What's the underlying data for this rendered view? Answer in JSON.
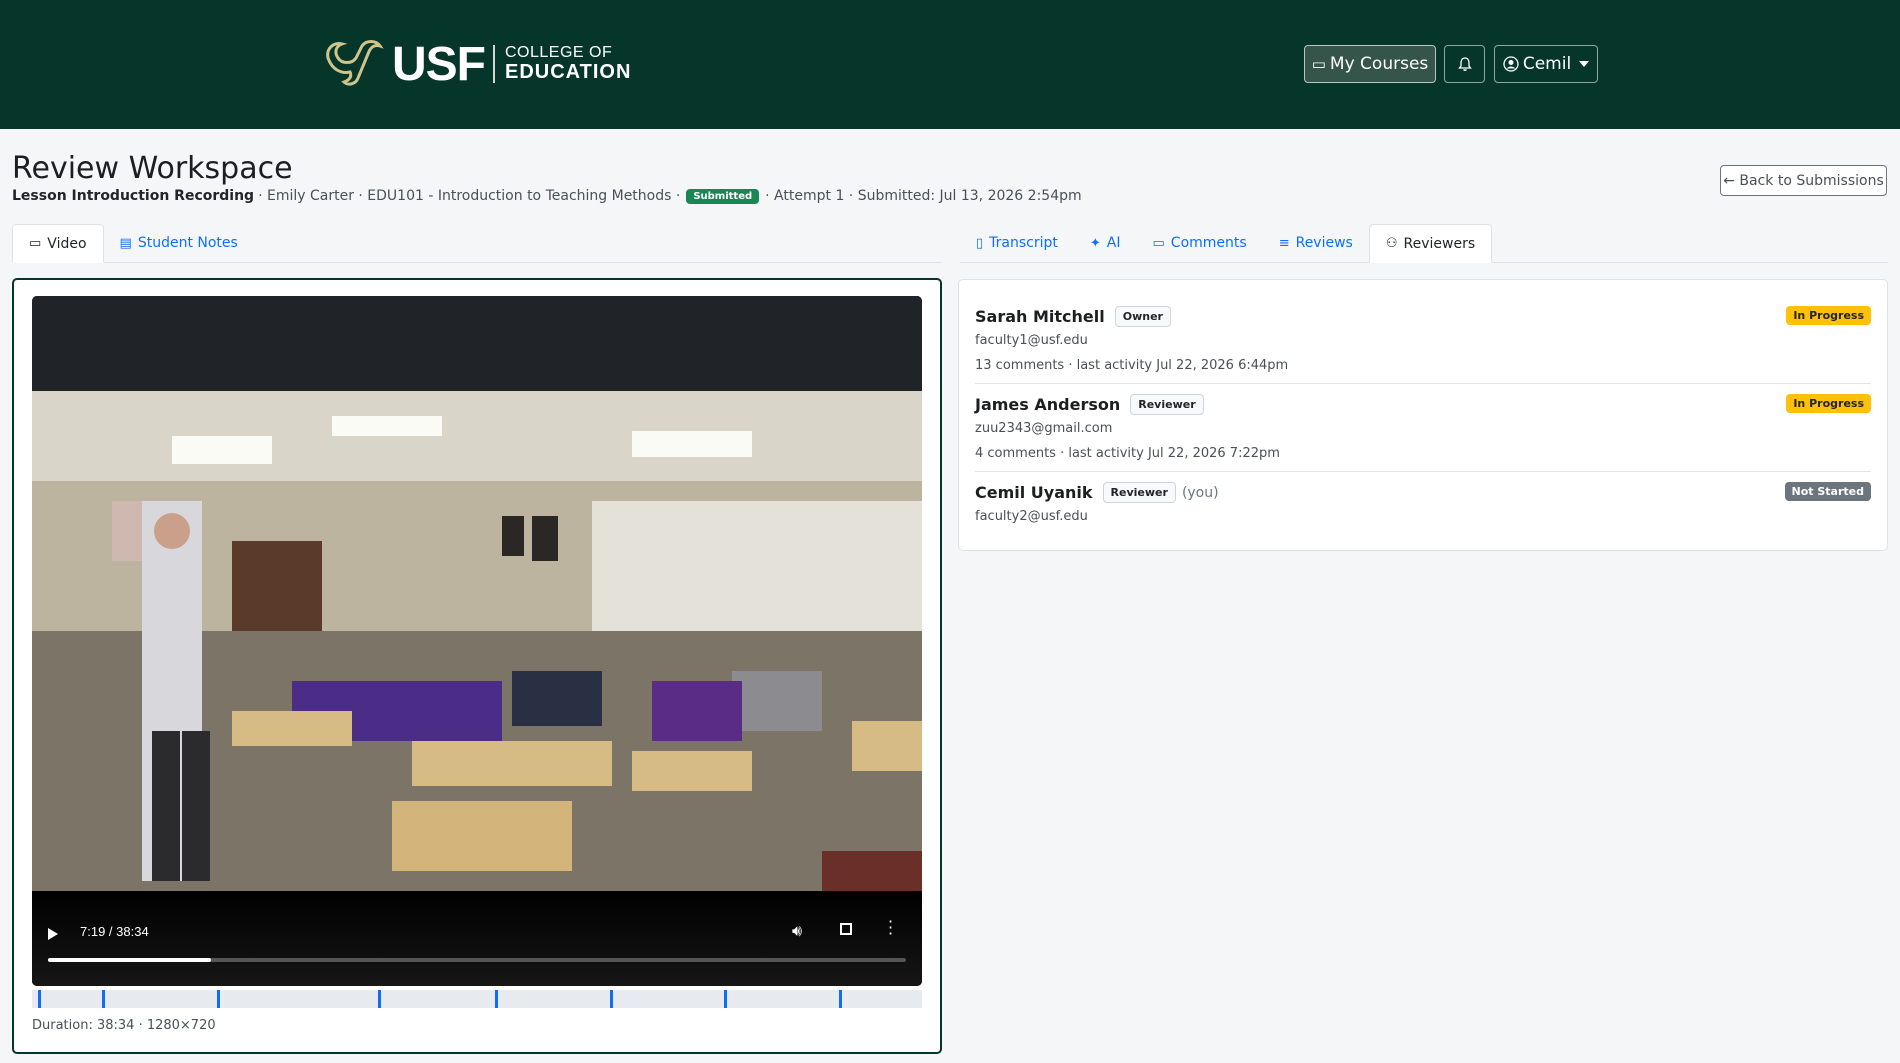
{
  "header": {
    "logo_text": "USF",
    "logo_college_line1": "COLLEGE OF",
    "logo_college_line2": "EDUCATION",
    "my_courses_label": "My Courses",
    "user_label": "Cemil"
  },
  "page": {
    "title": "Review Workspace",
    "submission_name": "Lesson Introduction Recording",
    "meta_student_course": "· Emily Carter · EDU101 - Introduction to Teaching Methods ·",
    "status_badge": "Submitted",
    "meta_attempt": "· Attempt 1 · Submitted: Jul 13, 2026 2:54pm",
    "back_button": "← Back to Submissions"
  },
  "left_tabs": [
    {
      "label": "Video",
      "icon": "video-icon",
      "active": true
    },
    {
      "label": "Student Notes",
      "icon": "notes-icon",
      "active": false
    }
  ],
  "right_tabs": [
    {
      "label": "Transcript",
      "icon": "transcript-icon",
      "active": false
    },
    {
      "label": "AI",
      "icon": "sparkle-icon",
      "active": false
    },
    {
      "label": "Comments",
      "icon": "comments-icon",
      "active": false
    },
    {
      "label": "Reviews",
      "icon": "list-icon",
      "active": false
    },
    {
      "label": "Reviewers",
      "icon": "people-icon",
      "active": true
    }
  ],
  "video": {
    "time_display": "7:19 / 38:34",
    "progress_fraction": 0.19,
    "duration_text": "Duration: 38:34 · 1280×720",
    "comment_marker_fractions": [
      0.007,
      0.079,
      0.208,
      0.389,
      0.52,
      0.649,
      0.778,
      0.907
    ]
  },
  "reviewers": [
    {
      "name": "Sarah Mitchell",
      "role": "Owner",
      "you": "",
      "email": "faculty1@usf.edu",
      "activity": "13 comments · last activity Jul 22, 2026 6:44pm",
      "status": "In Progress"
    },
    {
      "name": "James Anderson",
      "role": "Reviewer",
      "you": "",
      "email": "zuu2343@gmail.com",
      "activity": "4 comments · last activity Jul 22, 2026 7:22pm",
      "status": "In Progress"
    },
    {
      "name": "Cemil Uyanik",
      "role": "Reviewer",
      "you": "(you)",
      "email": "faculty2@usf.edu",
      "activity": "",
      "status": "Not Started"
    }
  ],
  "colors": {
    "brand_green": "#06362a",
    "link_blue": "#0d6efd",
    "in_progress": "#ffc107",
    "not_started": "#6c757d",
    "submitted": "#198754"
  }
}
